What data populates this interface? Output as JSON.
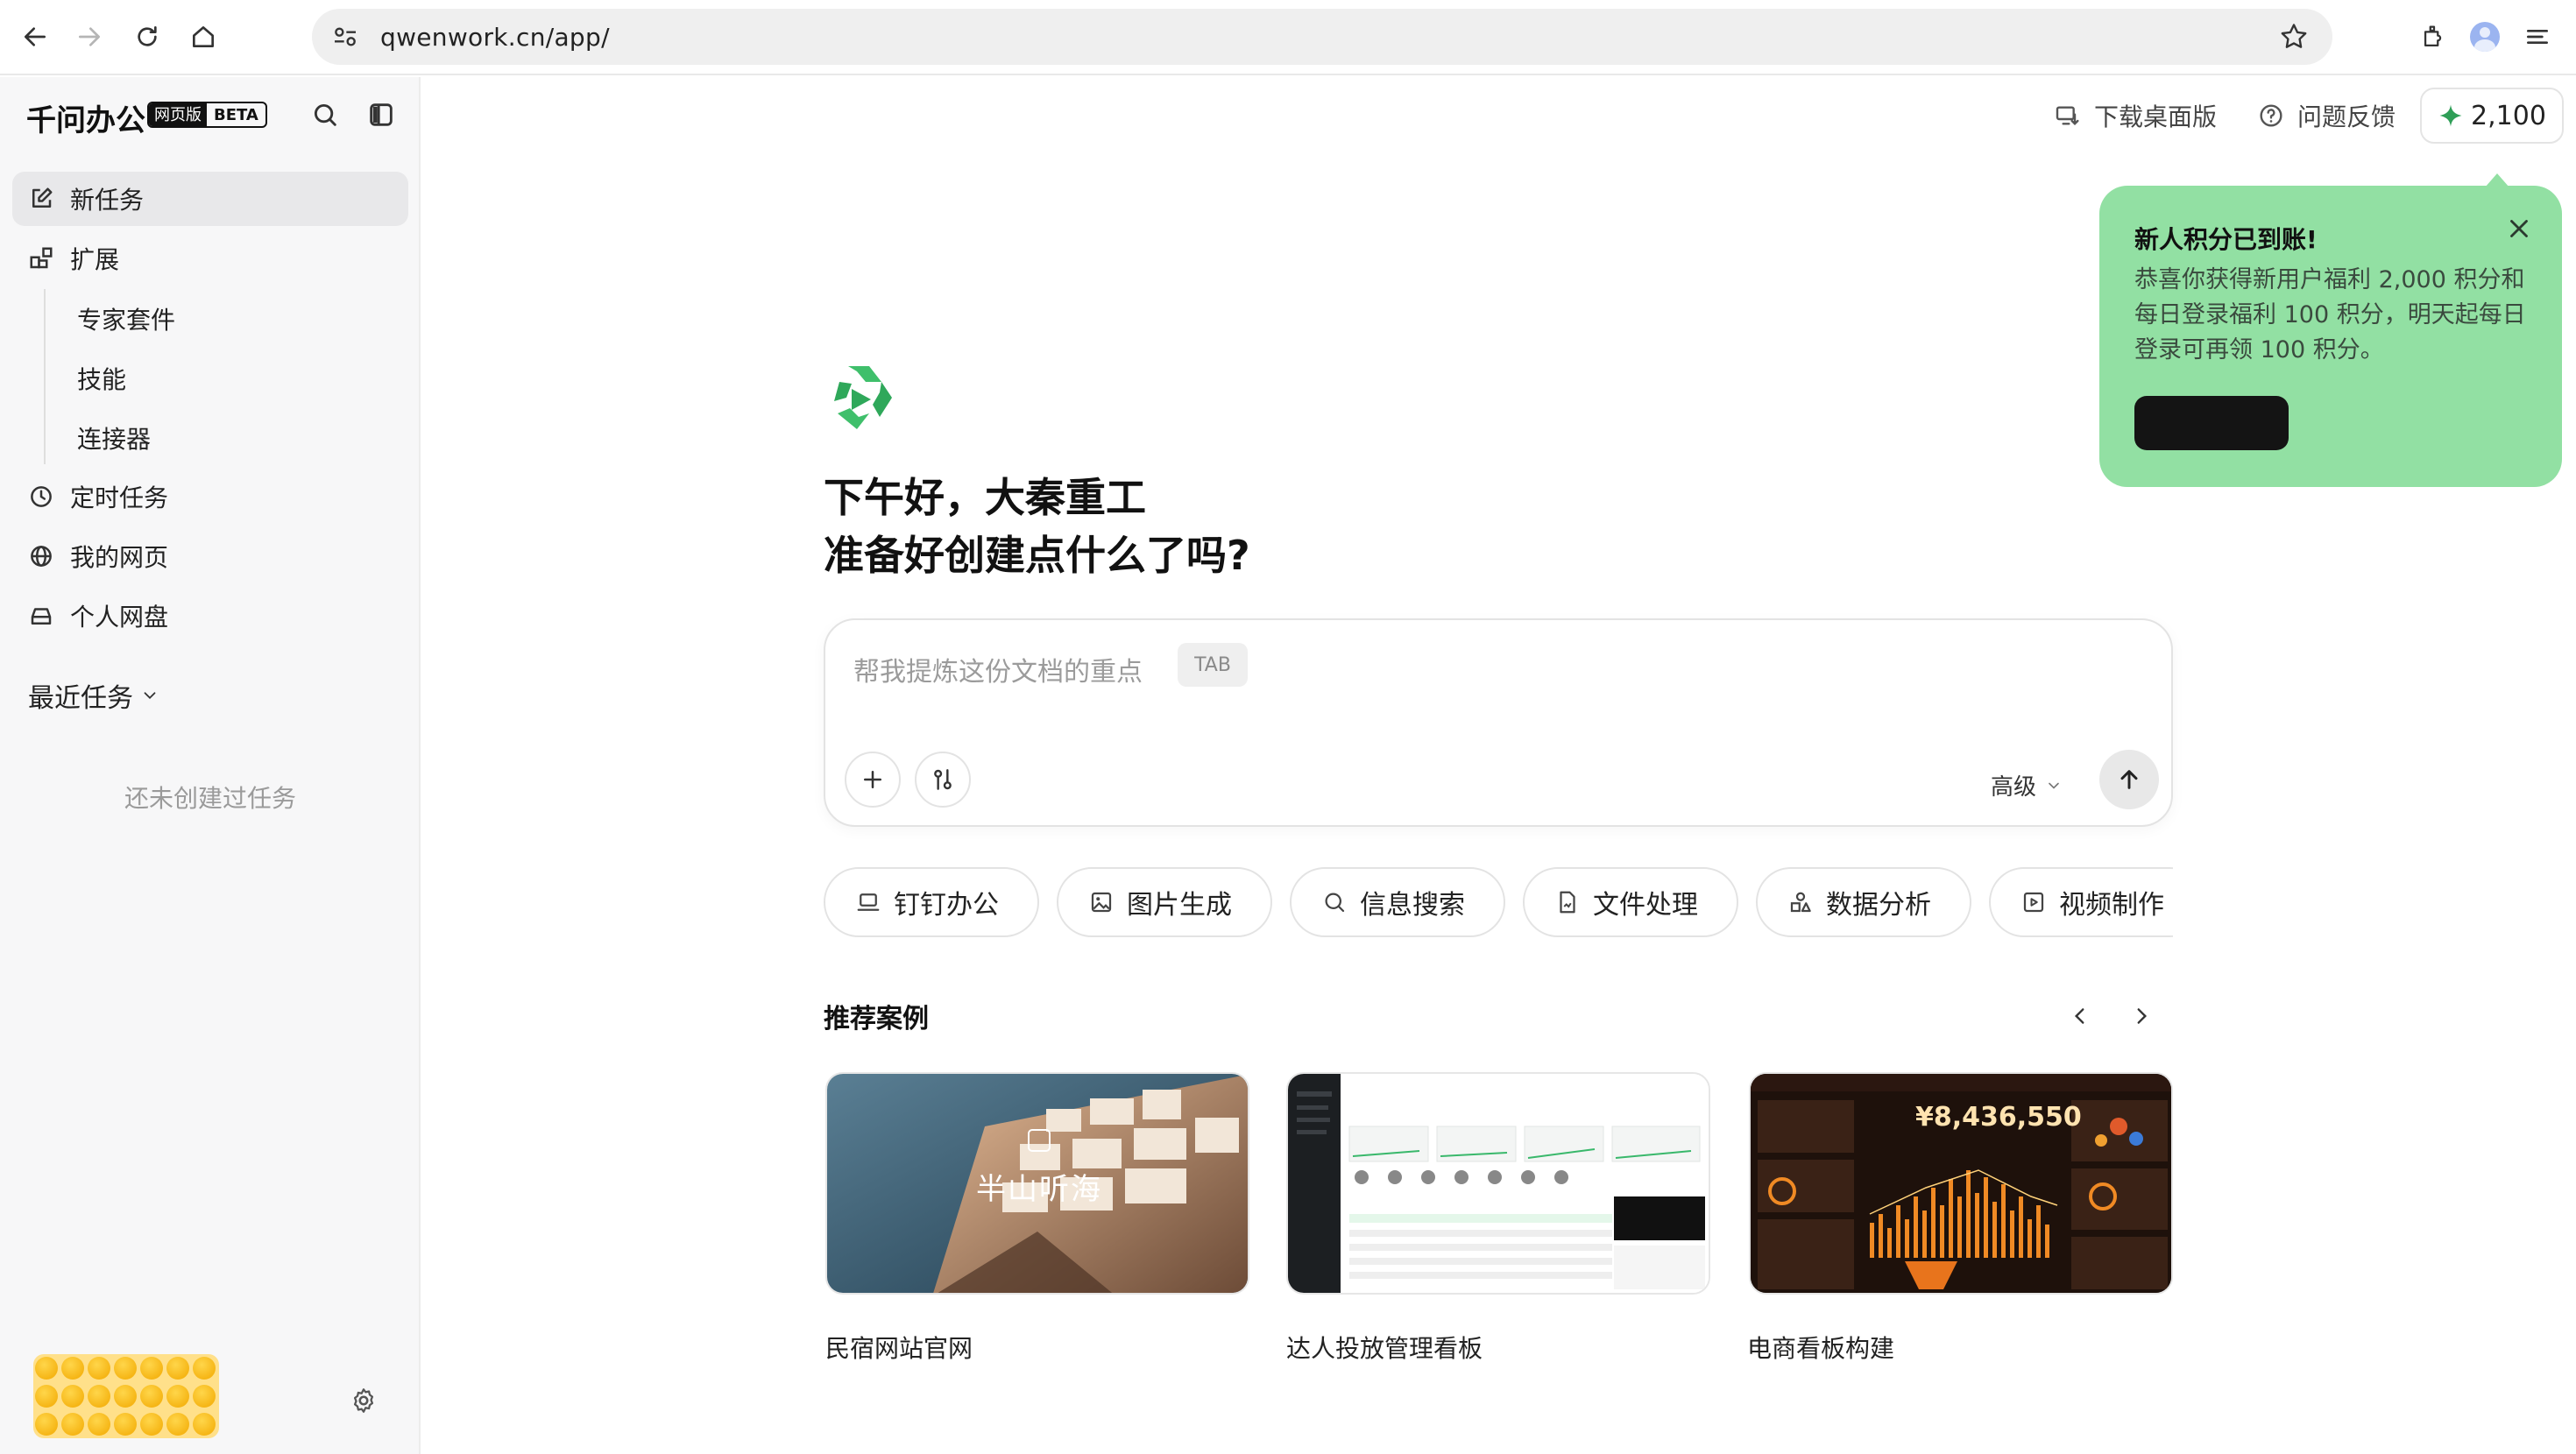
{
  "browser": {
    "url": "qwenwork.cn/app/"
  },
  "sidebar": {
    "brand": "千问办公",
    "badge_web": "网页版",
    "badge_beta": "BETA",
    "items": [
      {
        "label": "新任务",
        "icon": "edit-icon"
      },
      {
        "label": "扩展",
        "icon": "extension-icon"
      }
    ],
    "sub_items": [
      "专家套件",
      "技能",
      "连接器"
    ],
    "items2": [
      {
        "label": "定时任务",
        "icon": "clock-icon"
      },
      {
        "label": "我的网页",
        "icon": "globe-icon"
      },
      {
        "label": "个人网盘",
        "icon": "drive-icon"
      }
    ],
    "recent_label": "最近任务",
    "empty_text": "还未创建过任务"
  },
  "topbar": {
    "download": "下载桌面版",
    "feedback": "问题反馈",
    "points": "2,100"
  },
  "toast": {
    "title": "新人积分已到账!",
    "body": "恭喜你获得新用户福利 2,000 积分和每日登录福利 100 积分，明天起每日登录可再领 100 积分。"
  },
  "hero": {
    "line1": "下午好，大秦重工",
    "line2": "准备好创建点什么了吗?"
  },
  "input": {
    "placeholder": "帮我提炼这份文档的重点",
    "tab_key": "TAB",
    "advanced": "高级"
  },
  "chips": [
    {
      "label": "钉钉办公",
      "icon": "laptop-icon"
    },
    {
      "label": "图片生成",
      "icon": "image-icon"
    },
    {
      "label": "信息搜索",
      "icon": "search-icon"
    },
    {
      "label": "文件处理",
      "icon": "file-icon"
    },
    {
      "label": "数据分析",
      "icon": "shapes-icon"
    },
    {
      "label": "视频制作",
      "icon": "video-icon"
    }
  ],
  "recommended": {
    "title": "推荐案例",
    "cards": [
      {
        "caption": "民宿网站官网",
        "overlay": "半山听海"
      },
      {
        "caption": "达人投放管理看板"
      },
      {
        "caption": "电商看板构建",
        "amount": "¥8,436,550"
      }
    ]
  },
  "colors": {
    "accent_green": "#3fbf6b",
    "toast_bg": "#92e0a3"
  }
}
